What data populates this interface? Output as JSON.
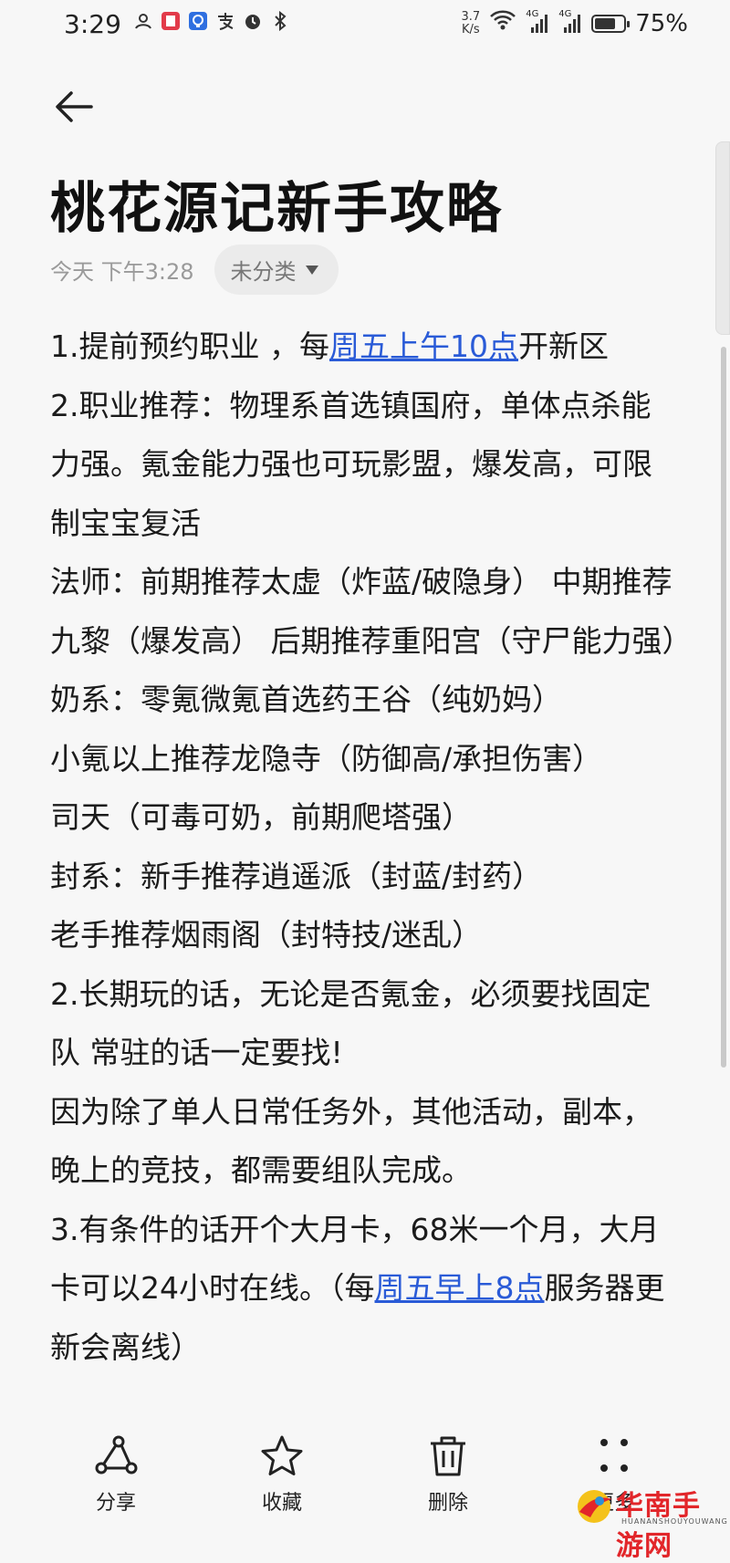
{
  "status_bar": {
    "time": "3:29",
    "net_speed_value": "3.7",
    "net_speed_unit": "K/s",
    "signal1_label": "4G",
    "signal2_label": "4G",
    "battery_percent": "75%",
    "battery_level": 0.75
  },
  "note": {
    "title": "桃花源记新手攻略",
    "date": "今天 下午3:28",
    "category": "未分类"
  },
  "content": {
    "l1_a": "1.提前预约职业 ，每",
    "l1_link": "周五上午10点",
    "l1_b": "开新区",
    "l2": "2.职业推荐：物理系首选镇国府，单体点杀能力强。氪金能力强也可玩影盟，爆发高，可限制宝宝复活",
    "l3": "法师：前期推荐太虚（炸蓝/破隐身） 中期推荐九黎（爆发高） 后期推荐重阳宫（守尸能力强）",
    "l4": "奶系：零氪微氪首选药王谷（纯奶妈）",
    "l5": "小氪以上推荐龙隐寺（防御高/承担伤害）",
    "l6": "司天（可毒可奶，前期爬塔强）",
    "l7": "封系：新手推荐逍遥派（封蓝/封药）",
    "l8": "老手推荐烟雨阁（封特技/迷乱）",
    "l9": "2.长期玩的话，无论是否氪金，必须要找固定队 常驻的话一定要找!",
    "l10": "因为除了单人日常任务外，其他活动，副本，晚上的竞技，都需要组队完成。",
    "l11_a": "3.有条件的话开个大月卡，68米一个月，大月卡可以24小时在线。（每",
    "l11_link": "周五早上8点",
    "l11_b": "服务器更新会离线）"
  },
  "bottom_bar": {
    "share": "分享",
    "favorite": "收藏",
    "delete": "删除",
    "more": "更多"
  },
  "watermark": {
    "brand": "华南手游网",
    "sub": "HUANANSHOUYOUWANG"
  },
  "colors": {
    "background": "#f7f7f7",
    "link": "#2a5bd7",
    "watermark_red": "#e2262a"
  }
}
